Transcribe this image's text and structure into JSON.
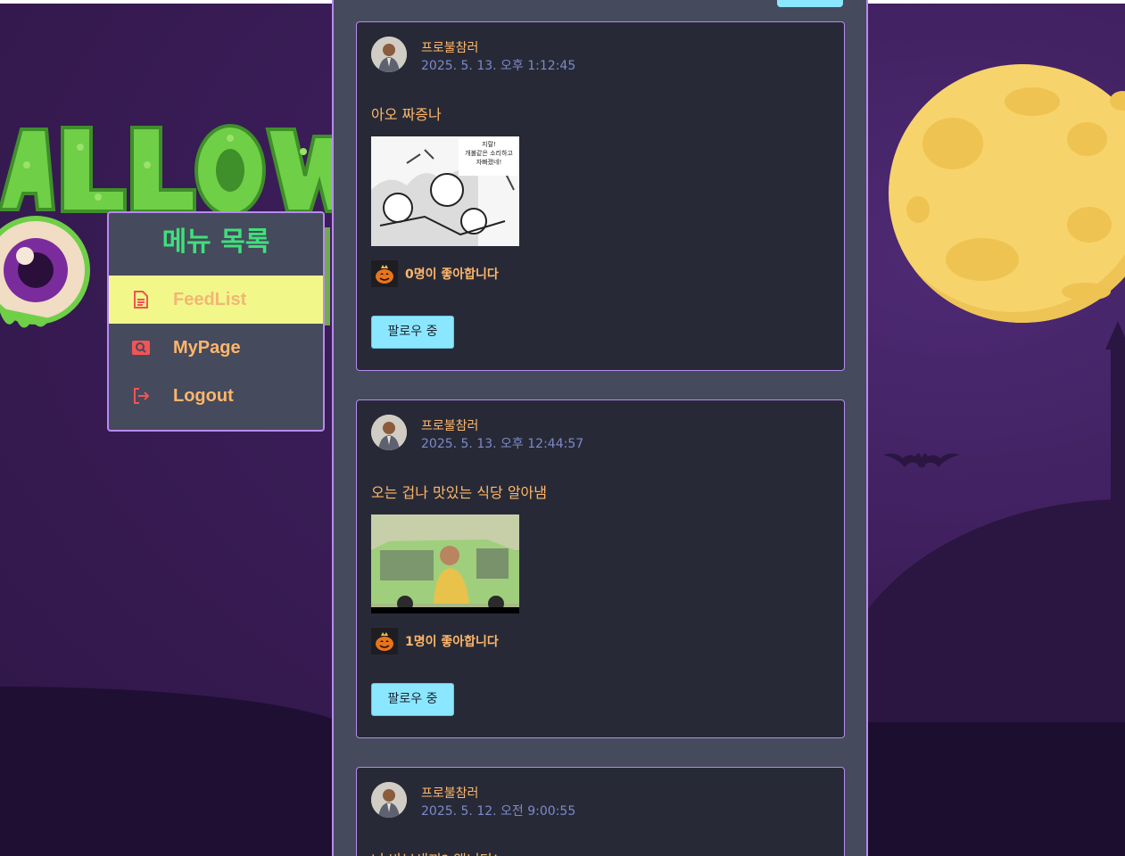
{
  "menu": {
    "title": "메뉴 목록",
    "items": [
      {
        "label": "FeedList",
        "icon": "document-icon",
        "active": true
      },
      {
        "label": "MyPage",
        "icon": "search-card-icon",
        "active": false
      },
      {
        "label": "Logout",
        "icon": "logout-icon",
        "active": false
      }
    ]
  },
  "posts": [
    {
      "author": "프로불참러",
      "timestamp": "2025. 5. 13. 오후 1:12:45",
      "text": "아오 짜증나",
      "image": "manga-panel-image",
      "likes": "0명이 좋아합니다",
      "follow_label": "팔로우 중"
    },
    {
      "author": "프로불참러",
      "timestamp": "2025. 5. 13. 오후 12:44:57",
      "text": "오는 겁나 맛있는 식당 알아냄",
      "image": "taxi-driver-image",
      "likes": "1명이 좋아합니다",
      "follow_label": "팔로우 중"
    },
    {
      "author": "프로불참러",
      "timestamp": "2025. 5. 12. 오전 9:00:55",
      "text": "너 바보새끼? 앱니다!",
      "image": "",
      "likes": "",
      "follow_label": ""
    }
  ],
  "manga_panel_text": "지랄!\n개불같은 소리하고\n자빠졌네!",
  "theme": {
    "accent_border": "#b78af0",
    "menu_title": "#3fe07a",
    "active_item_bg": "#f2f789",
    "label_orange": "#ffb66b",
    "follow_button": "#8be7ff",
    "timestamp": "#7d89c9"
  }
}
